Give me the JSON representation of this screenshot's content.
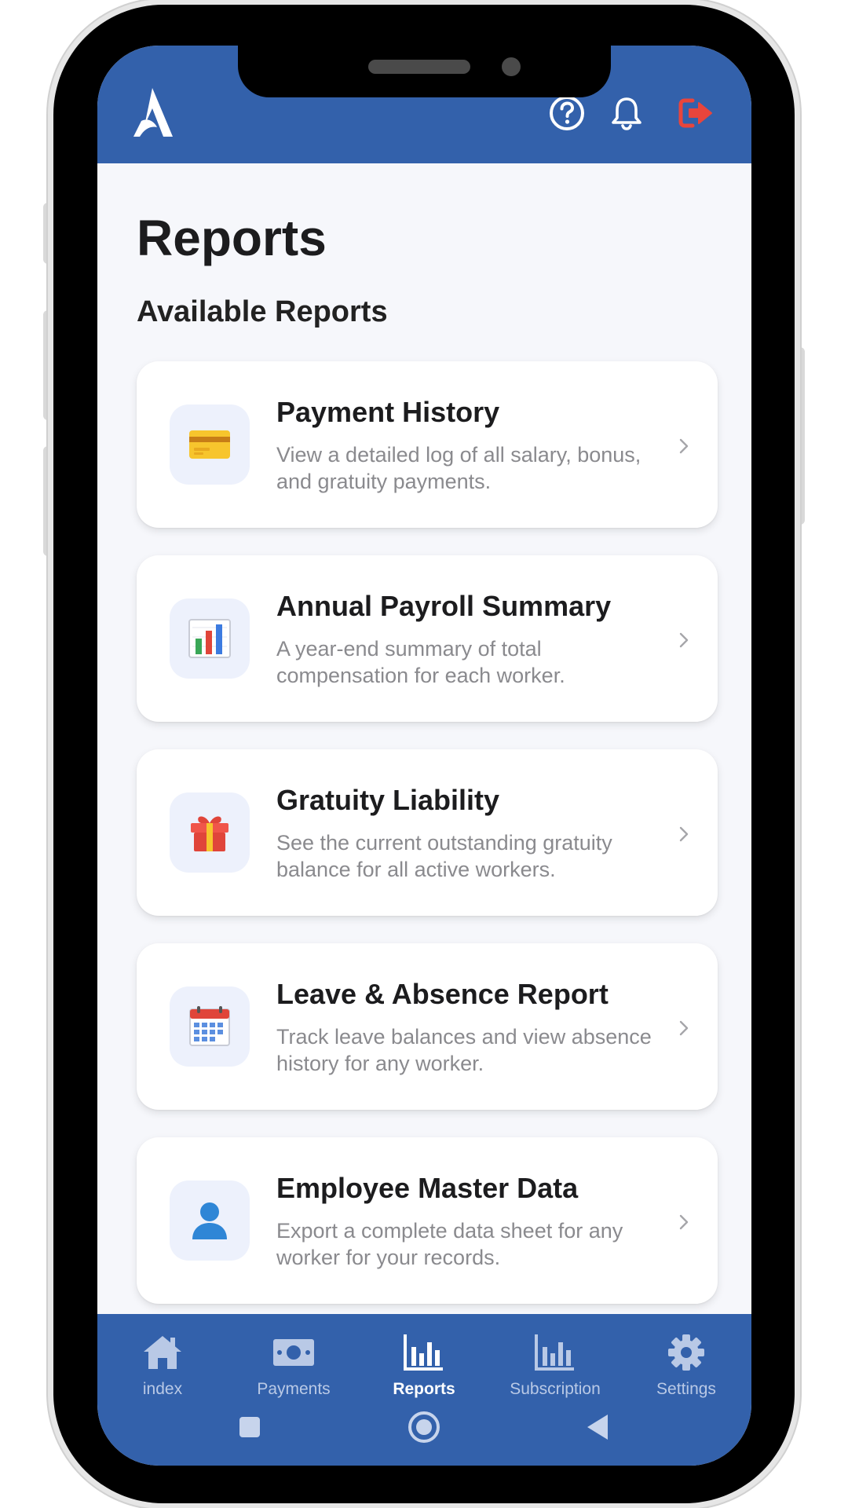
{
  "header": {
    "logo": "brand-logo",
    "icons": [
      "help-circle-icon",
      "bell-icon",
      "logout-icon"
    ],
    "brand_color": "#3361ab",
    "logout_color": "#e8453c"
  },
  "page": {
    "title": "Reports",
    "section_title": "Available Reports"
  },
  "reports": [
    {
      "icon": "credit-card-icon",
      "title": "Payment History",
      "description": "View a detailed log of all salary, bonus, and gratuity payments."
    },
    {
      "icon": "bar-chart-icon",
      "title": "Annual Payroll Summary",
      "description": "A year-end summary of total compensation for each worker."
    },
    {
      "icon": "gift-icon",
      "title": "Gratuity Liability",
      "description": "See the current outstanding gratuity balance for all active workers."
    },
    {
      "icon": "calendar-icon",
      "title": "Leave & Absence Report",
      "description": "Track leave balances and view absence history for any worker."
    },
    {
      "icon": "person-icon",
      "title": "Employee Master Data",
      "description": "Export a complete data sheet for any worker for your records."
    }
  ],
  "tabs": [
    {
      "label": "index",
      "icon": "home-icon",
      "active": false
    },
    {
      "label": "Payments",
      "icon": "cash-icon",
      "active": false
    },
    {
      "label": "Reports",
      "icon": "reports-chart-icon",
      "active": true
    },
    {
      "label": "Subscription",
      "icon": "subscription-chart-icon",
      "active": false
    },
    {
      "label": "Settings",
      "icon": "gear-icon",
      "active": false
    }
  ],
  "system_nav": [
    "square-icon",
    "circle-icon",
    "back-triangle-icon"
  ]
}
